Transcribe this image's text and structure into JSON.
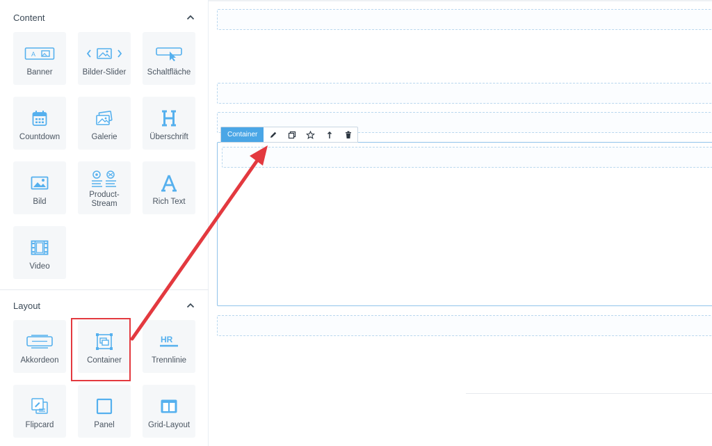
{
  "sidebar": {
    "content": {
      "title": "Content",
      "items": [
        {
          "label": "Banner",
          "icon": "banner-icon"
        },
        {
          "label": "Bilder-Slider",
          "icon": "image-slider-icon"
        },
        {
          "label": "Schaltfläche",
          "icon": "button-cursor-icon"
        },
        {
          "label": "Countdown",
          "icon": "calendar-icon"
        },
        {
          "label": "Galerie",
          "icon": "gallery-icon"
        },
        {
          "label": "Überschrift",
          "icon": "heading-h-icon"
        },
        {
          "label": "Bild",
          "icon": "image-icon"
        },
        {
          "label": "Product-Stream",
          "icon": "product-stream-icon"
        },
        {
          "label": "Rich Text",
          "icon": "rich-text-a-icon"
        },
        {
          "label": "Video",
          "icon": "film-icon"
        }
      ]
    },
    "layout": {
      "title": "Layout",
      "items": [
        {
          "label": "Akkordeon",
          "icon": "accordion-icon"
        },
        {
          "label": "Container",
          "icon": "container-icon"
        },
        {
          "label": "Trennlinie",
          "icon": "hr-icon"
        },
        {
          "label": "Flipcard",
          "icon": "flipcard-icon"
        },
        {
          "label": "Panel",
          "icon": "panel-icon"
        },
        {
          "label": "Grid-Layout",
          "icon": "grid-layout-icon"
        }
      ]
    }
  },
  "toolbar": {
    "label": "Container",
    "actions": [
      "edit-pencil-icon",
      "duplicate-icon",
      "favorite-star-icon",
      "move-up-icon",
      "delete-trash-icon"
    ]
  },
  "colors": {
    "accent": "#4aa6e6",
    "icon": "#55b0ee",
    "annotation": "#e3393f",
    "tile_bg": "#f5f7f9"
  }
}
